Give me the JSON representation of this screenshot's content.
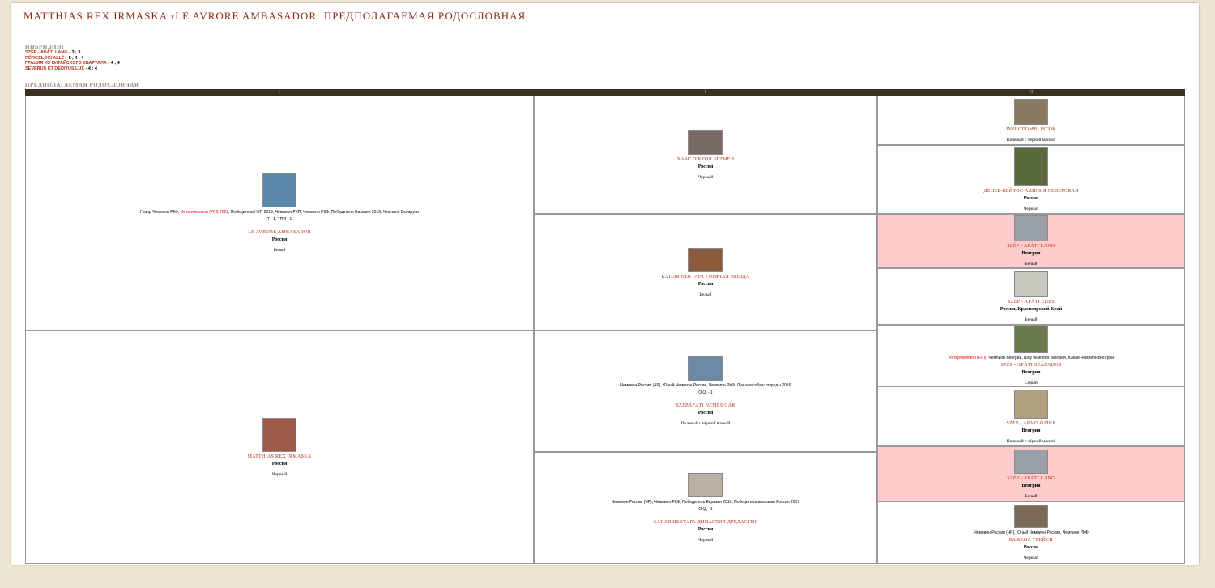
{
  "header": {
    "title_sire": "MATTHIAS REX IRMASKA",
    "title_x": "x",
    "title_dam": "LE AVRORE AMBASADOR",
    "title_suffix": ": ПРЕДПОЛАГАЕМАЯ РОДОСЛОВНАЯ"
  },
  "inbreeding": {
    "heading": "ИНБРИДИНГ",
    "items": [
      {
        "name": "SZÉP - APÁTI LANG",
        "count": " - 3 ; 3"
      },
      {
        "name": "PÖRGELÖCI ALLÉ",
        "count": " - 5 , 4 ; 4"
      },
      {
        "name": "ГРАЦИЯ ИЗ КИТАЙСКОГО КВАРТАЛА",
        "count": " - 4 ; 4"
      },
      {
        "name": "SEVERUS ET DEDITUS LUX",
        "count": " - 4 ; 4"
      }
    ]
  },
  "pedigree": {
    "heading": "ПРЕДПОЛАГАЕМАЯ РОДОСЛОВНАЯ",
    "columns": [
      "I",
      "II",
      "III"
    ],
    "gen1": [
      {
        "titles_pre": "Гранд Чемпион РКФ, ",
        "titles_red": "Интерчемпион (FCI) 2022",
        "titles_post": ", Победитель НКП 2019, Чемпион РКП, Чемпион РКФ, Победитель Евразии 2019, Чемпион Беларуси",
        "score": "Т - 1, ТПИ - 1",
        "name": "LE AVRORE AMBASADOR",
        "country": "Россия",
        "color": "Белый",
        "photo_color": "#5a86a8"
      },
      {
        "titles_pre": "",
        "titles_red": "",
        "titles_post": "",
        "score": "",
        "name": "MATTHIAS REX IRMASKA",
        "country": "Россия",
        "color": "Черный",
        "photo_color": "#9c5a48"
      }
    ],
    "gen2": [
      {
        "titles": "",
        "score": "",
        "name": "ХААГ ОФ ОЗЛ БЕТМЕН",
        "country": "Россия",
        "color": "Черный",
        "photo_color": "#7a6a66"
      },
      {
        "titles": "",
        "score": "",
        "name": "КАПЛЯ НЕКТАРА ГОРЯЧАЯ ЗВЕЗДА",
        "country": "Россия",
        "color": "Белый",
        "photo_color": "#8a5a3a"
      },
      {
        "titles": "Чемпион России (ЧР), Юный Чемпион России, Чемпион РКФ, Лучшая собака породы 2016",
        "score": "ОКД - 1",
        "name": "SZÉPÁPÁTI NEMES CÁR",
        "country": "Россия",
        "color": "Палевый с чёрной маской",
        "photo_color": "#6a8aa8"
      },
      {
        "titles": "Чемпион России (ЧР), Чемпион РКФ, Победитель Евразии 2018, Победитель выставки Россия 2017",
        "score": "ОКД - 1",
        "name": "КАПЛЯ НЕКТАРА ДИНАСТИЯ ДРЕДАСТИЯ",
        "country": "Россия",
        "color": "Черный",
        "photo_color": "#b9b0a4"
      }
    ],
    "gen3": [
      {
        "pink": false,
        "titles_red": "",
        "titles": "",
        "name": "INSEGDOMBI ISTOK",
        "country": "",
        "color": "Палевый с чёрной маской",
        "photo_color": "#8a7a60"
      },
      {
        "pink": false,
        "titles_red": "",
        "titles": "",
        "name": "ДЕНЕБ-КЕЙТОС АЛИСИЯ СЕВЕРСКАЯ",
        "country": "Россия",
        "color": "Черный",
        "photo_color": "#5a6a3a"
      },
      {
        "pink": true,
        "titles_red": "",
        "titles": "",
        "name": "SZÉP - APÁTI LANG",
        "country": "Венгрия",
        "color": "Белый",
        "photo_color": "#9aa0a8"
      },
      {
        "pink": false,
        "titles_red": "",
        "titles": "",
        "name": "SZÉP - APÁTI EHES",
        "country": "Россия, Красноярский Край",
        "color": "Белый",
        "photo_color": "#c8c8c0"
      },
      {
        "pink": false,
        "titles_red": "Интерчемпион (FCI)",
        "titles": ", Чемпион Венгрии, Шоу чемпион Венгрии, Юный Чемпион Венгрии",
        "name": "SZÉP - APÁTI SZÁZADOS",
        "country": "Венгрия",
        "color": "Серый",
        "photo_color": "#6a7a4a"
      },
      {
        "pink": false,
        "titles_red": "",
        "titles": "",
        "name": "SZÉP - APÁTI ÖZIKE",
        "country": "Венгрия",
        "color": "Палевый с чёрной маской",
        "photo_color": "#b0a080"
      },
      {
        "pink": true,
        "titles_red": "",
        "titles": "",
        "name": "SZÉP - APÁTI LANG",
        "country": "Венгрия",
        "color": "Белый",
        "photo_color": "#9aa0a8"
      },
      {
        "pink": false,
        "titles_red": "",
        "titles": "Чемпион России (ЧР), Юный Чемпион России, Чемпион РКФ",
        "name": "БАЖЕНА ТРЕЙСИ",
        "country": "Россия",
        "color": "Черный",
        "photo_color": "#7a6a58"
      }
    ]
  }
}
